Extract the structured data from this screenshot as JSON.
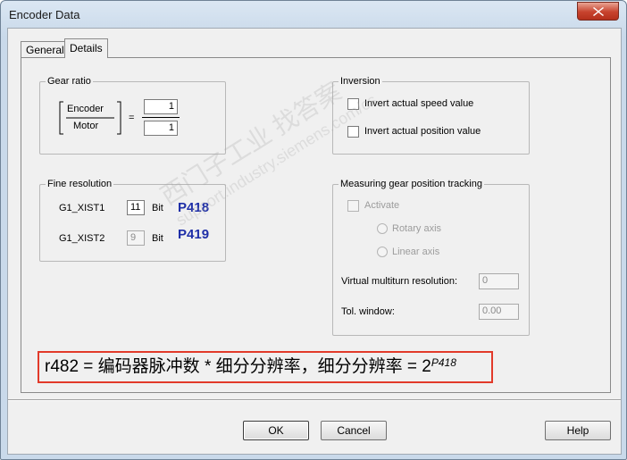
{
  "window": {
    "title": "Encoder Data"
  },
  "tabs": [
    {
      "label": "General"
    },
    {
      "label": "Details"
    }
  ],
  "gear_ratio": {
    "legend": "Gear ratio",
    "encoder_label": "Encoder",
    "motor_label": "Motor",
    "equals": "=",
    "numerator_value": "1",
    "denominator_value": "1"
  },
  "fine_resolution": {
    "legend": "Fine resolution",
    "g1_xist1_label": "G1_XIST1",
    "g1_xist1_value": "11",
    "g1_xist1_unit": "Bit",
    "g1_xist1_param": "P418",
    "g1_xist2_label": "G1_XIST2",
    "g1_xist2_value": "9",
    "g1_xist2_unit": "Bit",
    "g1_xist2_param": "P419"
  },
  "inversion": {
    "legend": "Inversion",
    "invert_speed_label": "Invert actual speed value",
    "invert_position_label": "Invert actual position value"
  },
  "measuring": {
    "legend": "Measuring gear position tracking",
    "activate_label": "Activate",
    "rotary_axis_label": "Rotary axis",
    "linear_axis_label": "Linear axis",
    "virtual_multiturn_label": "Virtual multiturn resolution:",
    "virtual_multiturn_value": "0",
    "tol_window_label": "Tol. window:",
    "tol_window_value": "0.00"
  },
  "annotation": {
    "formula_text": "r482 = 编码器脉冲数 * 细分分辨率，细分分辨率 = 2",
    "exponent": "P418"
  },
  "watermark": {
    "line1": "西门子工业",
    "line1b": "找答案",
    "line2": "support.industry.siemens.com/cs"
  },
  "buttons": {
    "ok": "OK",
    "cancel": "Cancel",
    "help": "Help"
  }
}
